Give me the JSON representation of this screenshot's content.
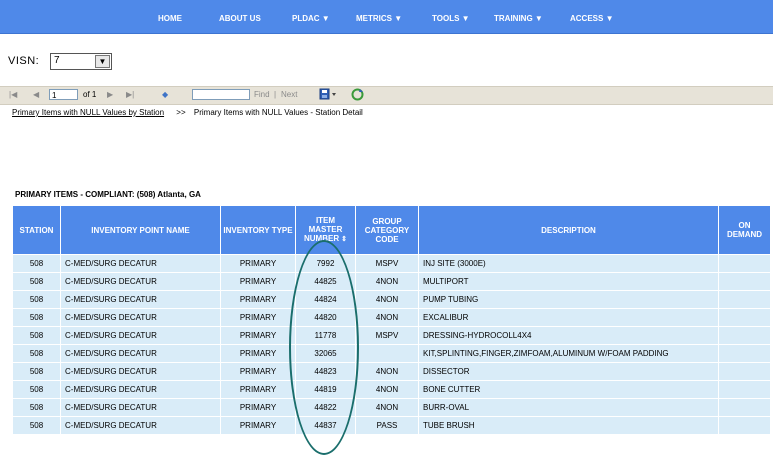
{
  "nav": {
    "items": [
      "HOME",
      "ABOUT US",
      "PLDAC ▼",
      "METRICS ▼",
      "TOOLS ▼",
      "TRAINING ▼",
      "ACCESS ▼"
    ]
  },
  "visn": {
    "label": "VISN:",
    "value": "7"
  },
  "toolbar": {
    "page_value": "1",
    "of_pages": "of 1",
    "find_label": "Find",
    "separator": "|",
    "next_label": "Next"
  },
  "breadcrumb": {
    "link": "Primary Items with NULL Values by Station",
    "sep": ">>",
    "current": "Primary Items with NULL Values - Station Detail"
  },
  "report_title": "PRIMARY ITEMS - COMPLIANT: (508) Atlanta, GA",
  "table": {
    "headers": [
      "STATION",
      "INVENTORY POINT NAME",
      "INVENTORY TYPE",
      "ITEM MASTER NUMBER",
      "GROUP CATEGORY CODE",
      "DESCRIPTION",
      "ON DEMAND"
    ],
    "rows": [
      [
        "508",
        "C-MED/SURG DECATUR",
        "PRIMARY",
        "7992",
        "MSPV",
        "INJ SITE (3000E)",
        ""
      ],
      [
        "508",
        "C-MED/SURG DECATUR",
        "PRIMARY",
        "44825",
        "4NON",
        "MULTIPORT",
        ""
      ],
      [
        "508",
        "C-MED/SURG DECATUR",
        "PRIMARY",
        "44824",
        "4NON",
        "PUMP TUBING",
        ""
      ],
      [
        "508",
        "C-MED/SURG DECATUR",
        "PRIMARY",
        "44820",
        "4NON",
        "EXCALIBUR",
        ""
      ],
      [
        "508",
        "C-MED/SURG DECATUR",
        "PRIMARY",
        "11778",
        "MSPV",
        "DRESSING-HYDROCOLL4X4",
        ""
      ],
      [
        "508",
        "C-MED/SURG DECATUR",
        "PRIMARY",
        "32065",
        "",
        "KIT,SPLINTING,FINGER,ZIMFOAM,ALUMINUM W/FOAM PADDING",
        ""
      ],
      [
        "508",
        "C-MED/SURG DECATUR",
        "PRIMARY",
        "44823",
        "4NON",
        "DISSECTOR",
        ""
      ],
      [
        "508",
        "C-MED/SURG DECATUR",
        "PRIMARY",
        "44819",
        "4NON",
        "BONE CUTTER",
        ""
      ],
      [
        "508",
        "C-MED/SURG DECATUR",
        "PRIMARY",
        "44822",
        "4NON",
        "BURR-OVAL",
        ""
      ],
      [
        "508",
        "C-MED/SURG DECATUR",
        "PRIMARY",
        "44837",
        "PASS",
        "TUBE BRUSH",
        ""
      ]
    ]
  }
}
